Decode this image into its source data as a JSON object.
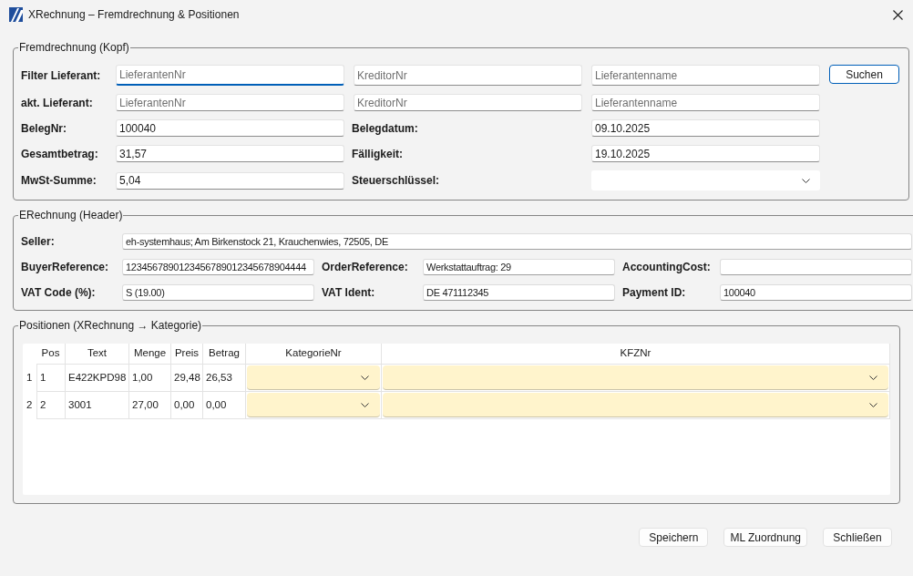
{
  "window": {
    "title": "XRechnung – Fremdrechnung & Positionen"
  },
  "kopf": {
    "legend": "Fremdrechnung (Kopf)",
    "rows": [
      {
        "label": "Filter Lieferant:",
        "cells": [
          {
            "kind": "field",
            "placeholder": "LieferantenNr",
            "focused": true
          },
          {
            "kind": "field",
            "placeholder": "KreditorNr",
            "focused": false
          },
          {
            "kind": "field",
            "placeholder": "Lieferantenname",
            "focused": false
          },
          {
            "kind": "button",
            "text": "Suchen"
          }
        ]
      },
      {
        "label": "akt. Lieferant:",
        "cells": [
          {
            "kind": "field",
            "placeholder": "LieferantenNr",
            "focused": false
          },
          {
            "kind": "field",
            "placeholder": "KreditorNr",
            "focused": false
          },
          {
            "kind": "field",
            "placeholder": "Lieferantenname",
            "focused": false
          }
        ]
      },
      {
        "label": "BelegNr:",
        "cells": [
          {
            "kind": "field",
            "value": "100040",
            "focused": false
          },
          {
            "kind": "label",
            "text": "Belegdatum:"
          },
          {
            "kind": "field",
            "value": "09.10.2025",
            "focused": false
          }
        ]
      },
      {
        "label": "Gesamtbetrag:",
        "cells": [
          {
            "kind": "field",
            "value": "31,57",
            "focused": false
          },
          {
            "kind": "label",
            "text": "Fälligkeit:"
          },
          {
            "kind": "field",
            "value": "19.10.2025",
            "focused": false
          }
        ]
      },
      {
        "label": "MwSt-Summe:",
        "cells": [
          {
            "kind": "field",
            "value": "5,04",
            "focused": false
          },
          {
            "kind": "label",
            "text": "Steuerschlüssel:"
          },
          {
            "kind": "combo"
          }
        ]
      }
    ]
  },
  "erechnung": {
    "legend": "ERechnung (Header)",
    "seller": {
      "label": "Seller:",
      "value": "eh-systemhaus; Am Birkenstock 21, Krauchenwies, 72505, DE"
    },
    "fields": [
      {
        "label": "BuyerReference:",
        "value": "1234567890123456789012345678904444"
      },
      {
        "label": "OrderReference:",
        "value": "Werkstattauftrag: 29"
      },
      {
        "label": "AccountingCost:"
      },
      {
        "label": "VAT Code (%):",
        "value": "S (19.00)"
      },
      {
        "label": "VAT Ident:",
        "value": "DE 471112345"
      },
      {
        "label": "Payment ID:",
        "value": "100040"
      }
    ]
  },
  "positionen": {
    "legend": "Positionen (XRechnung → Kategorie)",
    "table": {
      "columns": [
        "Pos",
        "Text",
        "Menge",
        "Preis",
        "Betrag",
        "KategorieNr",
        "KFZNr"
      ],
      "rows": [
        {
          "header": "1",
          "cells": [
            {
              "kind": "text",
              "text": "1"
            },
            {
              "kind": "text",
              "text": "E422KPD98"
            },
            {
              "kind": "text",
              "text": "1,00"
            },
            {
              "kind": "text",
              "text": "29,48"
            },
            {
              "kind": "text",
              "text": "26,53"
            },
            {
              "kind": "combo"
            },
            {
              "kind": "combo"
            }
          ]
        },
        {
          "header": "2",
          "cells": [
            {
              "kind": "text",
              "text": "2"
            },
            {
              "kind": "text",
              "text": "3001"
            },
            {
              "kind": "text",
              "text": "27,00"
            },
            {
              "kind": "text",
              "text": "0,00"
            },
            {
              "kind": "text",
              "text": "0,00"
            },
            {
              "kind": "combo"
            },
            {
              "kind": "combo"
            }
          ]
        }
      ]
    }
  },
  "buttons": [
    "Speichern",
    "ML Zuordnung",
    "Schließen"
  ]
}
